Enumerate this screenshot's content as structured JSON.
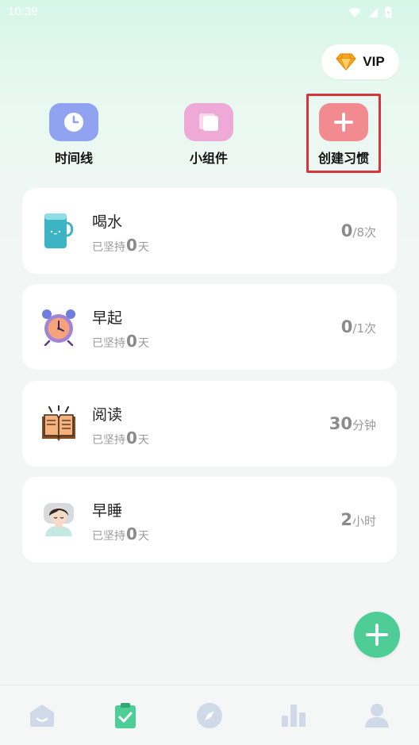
{
  "status_bar": {
    "time": "10:39"
  },
  "vip": {
    "label": "VIP"
  },
  "quick_actions": [
    {
      "label": "时间线",
      "icon": "clock-icon",
      "color": "#8fa3f0"
    },
    {
      "label": "小组件",
      "icon": "widget-icon",
      "color": "#efa9d6"
    },
    {
      "label": "创建习惯",
      "icon": "plus-icon",
      "color": "#f28b8f"
    }
  ],
  "habits": [
    {
      "name": "喝水",
      "icon": "cup-icon",
      "streak_prefix": "已坚持",
      "streak_count": "0",
      "streak_suffix": "天",
      "goal_value": "0",
      "goal_unit": "/8次"
    },
    {
      "name": "早起",
      "icon": "alarm-clock-icon",
      "streak_prefix": "已坚持",
      "streak_count": "0",
      "streak_suffix": "天",
      "goal_value": "0",
      "goal_unit": "/1次"
    },
    {
      "name": "阅读",
      "icon": "book-icon",
      "streak_prefix": "已坚持",
      "streak_count": "0",
      "streak_suffix": "天",
      "goal_value": "30",
      "goal_unit": "分钟"
    },
    {
      "name": "早睡",
      "icon": "sleeping-person-icon",
      "streak_prefix": "已坚持",
      "streak_count": "0",
      "streak_suffix": "天",
      "goal_value": "2",
      "goal_unit": "小时"
    }
  ],
  "bottom_nav": [
    {
      "icon": "home-icon",
      "active": false
    },
    {
      "icon": "clipboard-check-icon",
      "active": true
    },
    {
      "icon": "compass-icon",
      "active": false
    },
    {
      "icon": "bar-chart-icon",
      "active": false
    },
    {
      "icon": "profile-icon",
      "active": false
    }
  ],
  "colors": {
    "accent": "#4ecd97",
    "highlight": "#d8343b",
    "inactive_nav": "#cfd9e8"
  }
}
